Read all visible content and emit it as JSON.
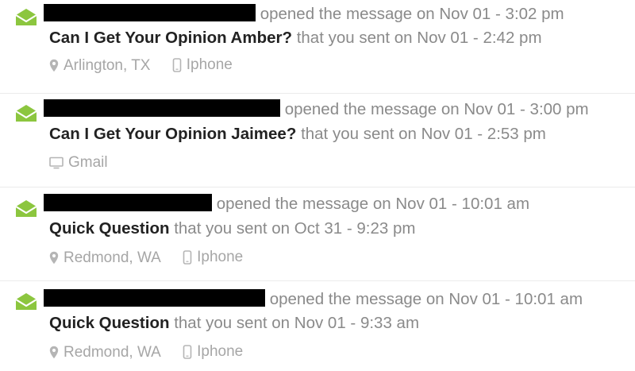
{
  "colors": {
    "envelope": "#8cc63f",
    "subject_text": "#222222",
    "muted_text": "#8a8a8a",
    "meta_text": "#a6a6a6",
    "redaction": "#000000",
    "divider": "#ebebeb"
  },
  "items": [
    {
      "opened_text": "opened the message on Nov 01 - 3:02 pm",
      "subject": "Can I Get Your Opinion Amber?",
      "sent_text": "that you sent on Nov 01 - 2:42 pm",
      "location": "Arlington, TX",
      "location_icon": "map-pin-icon",
      "device": "Iphone",
      "device_icon": "phone-icon"
    },
    {
      "opened_text": "opened the message on Nov 01 - 3:00 pm",
      "subject": "Can I Get Your Opinion Jaimee?",
      "sent_text": "that you sent on Nov 01 - 2:53 pm",
      "device": "Gmail",
      "device_icon": "monitor-icon"
    },
    {
      "opened_text": "opened the message on Nov 01 - 10:01 am",
      "subject": "Quick Question",
      "sent_text": "that you sent on Oct 31 - 9:23 pm",
      "location": "Redmond, WA",
      "location_icon": "map-pin-icon",
      "device": "Iphone",
      "device_icon": "phone-icon"
    },
    {
      "opened_text": "opened the message on Nov 01 - 10:01 am",
      "subject": "Quick Question",
      "sent_text": "that you sent on Nov 01 - 9:33 am",
      "location": "Redmond, WA",
      "location_icon": "map-pin-icon",
      "device": "Iphone",
      "device_icon": "phone-icon"
    }
  ]
}
